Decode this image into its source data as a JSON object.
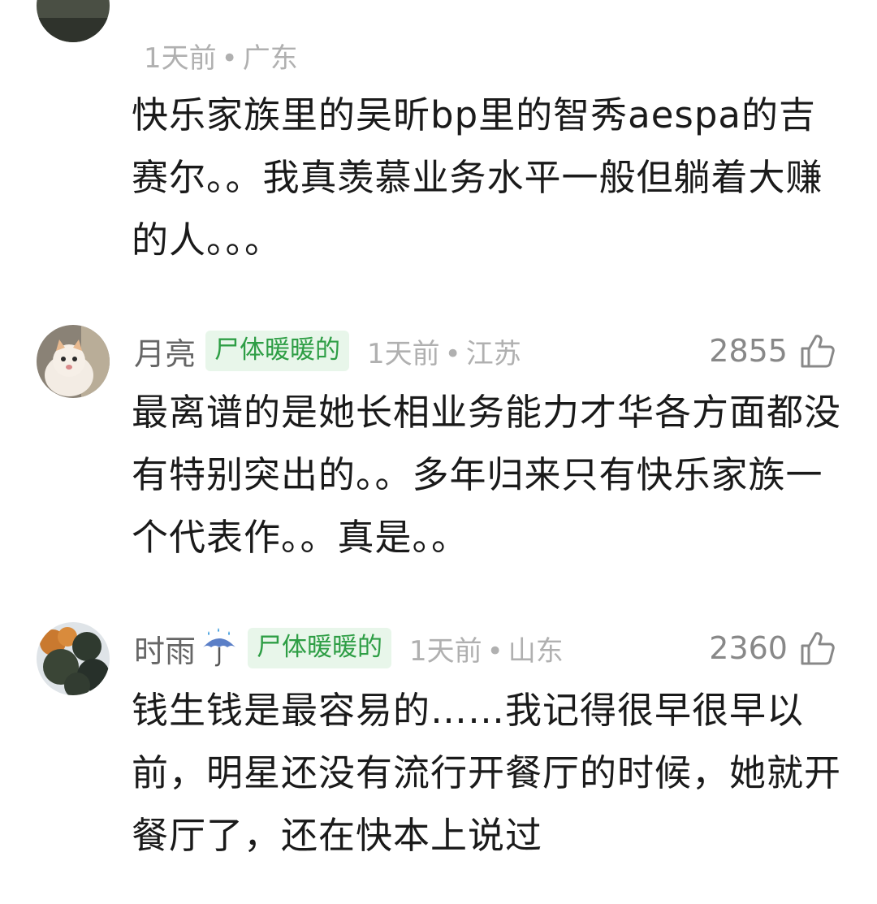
{
  "comments": [
    {
      "meta": {
        "time": "1天前",
        "location": "广东"
      },
      "text": "快乐家族里的吴昕bp里的智秀aespa的吉赛尔。。我真羡慕业务水平一般但躺着大赚的人。。。"
    },
    {
      "username": "月亮",
      "badge": "尸体暖暖的",
      "meta": {
        "time": "1天前",
        "location": "江苏"
      },
      "likes": "2855",
      "avatar_icon": "kitten-avatar-icon",
      "text": "最离谱的是她长相业务能力才华各方面都没有特别突出的。。多年归来只有快乐家族一个代表作。。真是。。"
    },
    {
      "username": "时雨",
      "user_emoji": "umbrella-rain-icon",
      "badge": "尸体暖暖的",
      "meta": {
        "time": "1天前",
        "location": "山东"
      },
      "likes": "2360",
      "avatar_icon": "autumn-tree-avatar-icon",
      "text": "钱生钱是最容易的……我记得很早很早以前，明星还没有流行开餐厅的时候，她就开餐厅了，还在快本上说过"
    }
  ],
  "meta_separator": "•",
  "colors": {
    "badge_bg": "#e8f6ea",
    "badge_text": "#2e9e45",
    "meta_text": "#b0b0b0",
    "username_text": "#666666"
  }
}
